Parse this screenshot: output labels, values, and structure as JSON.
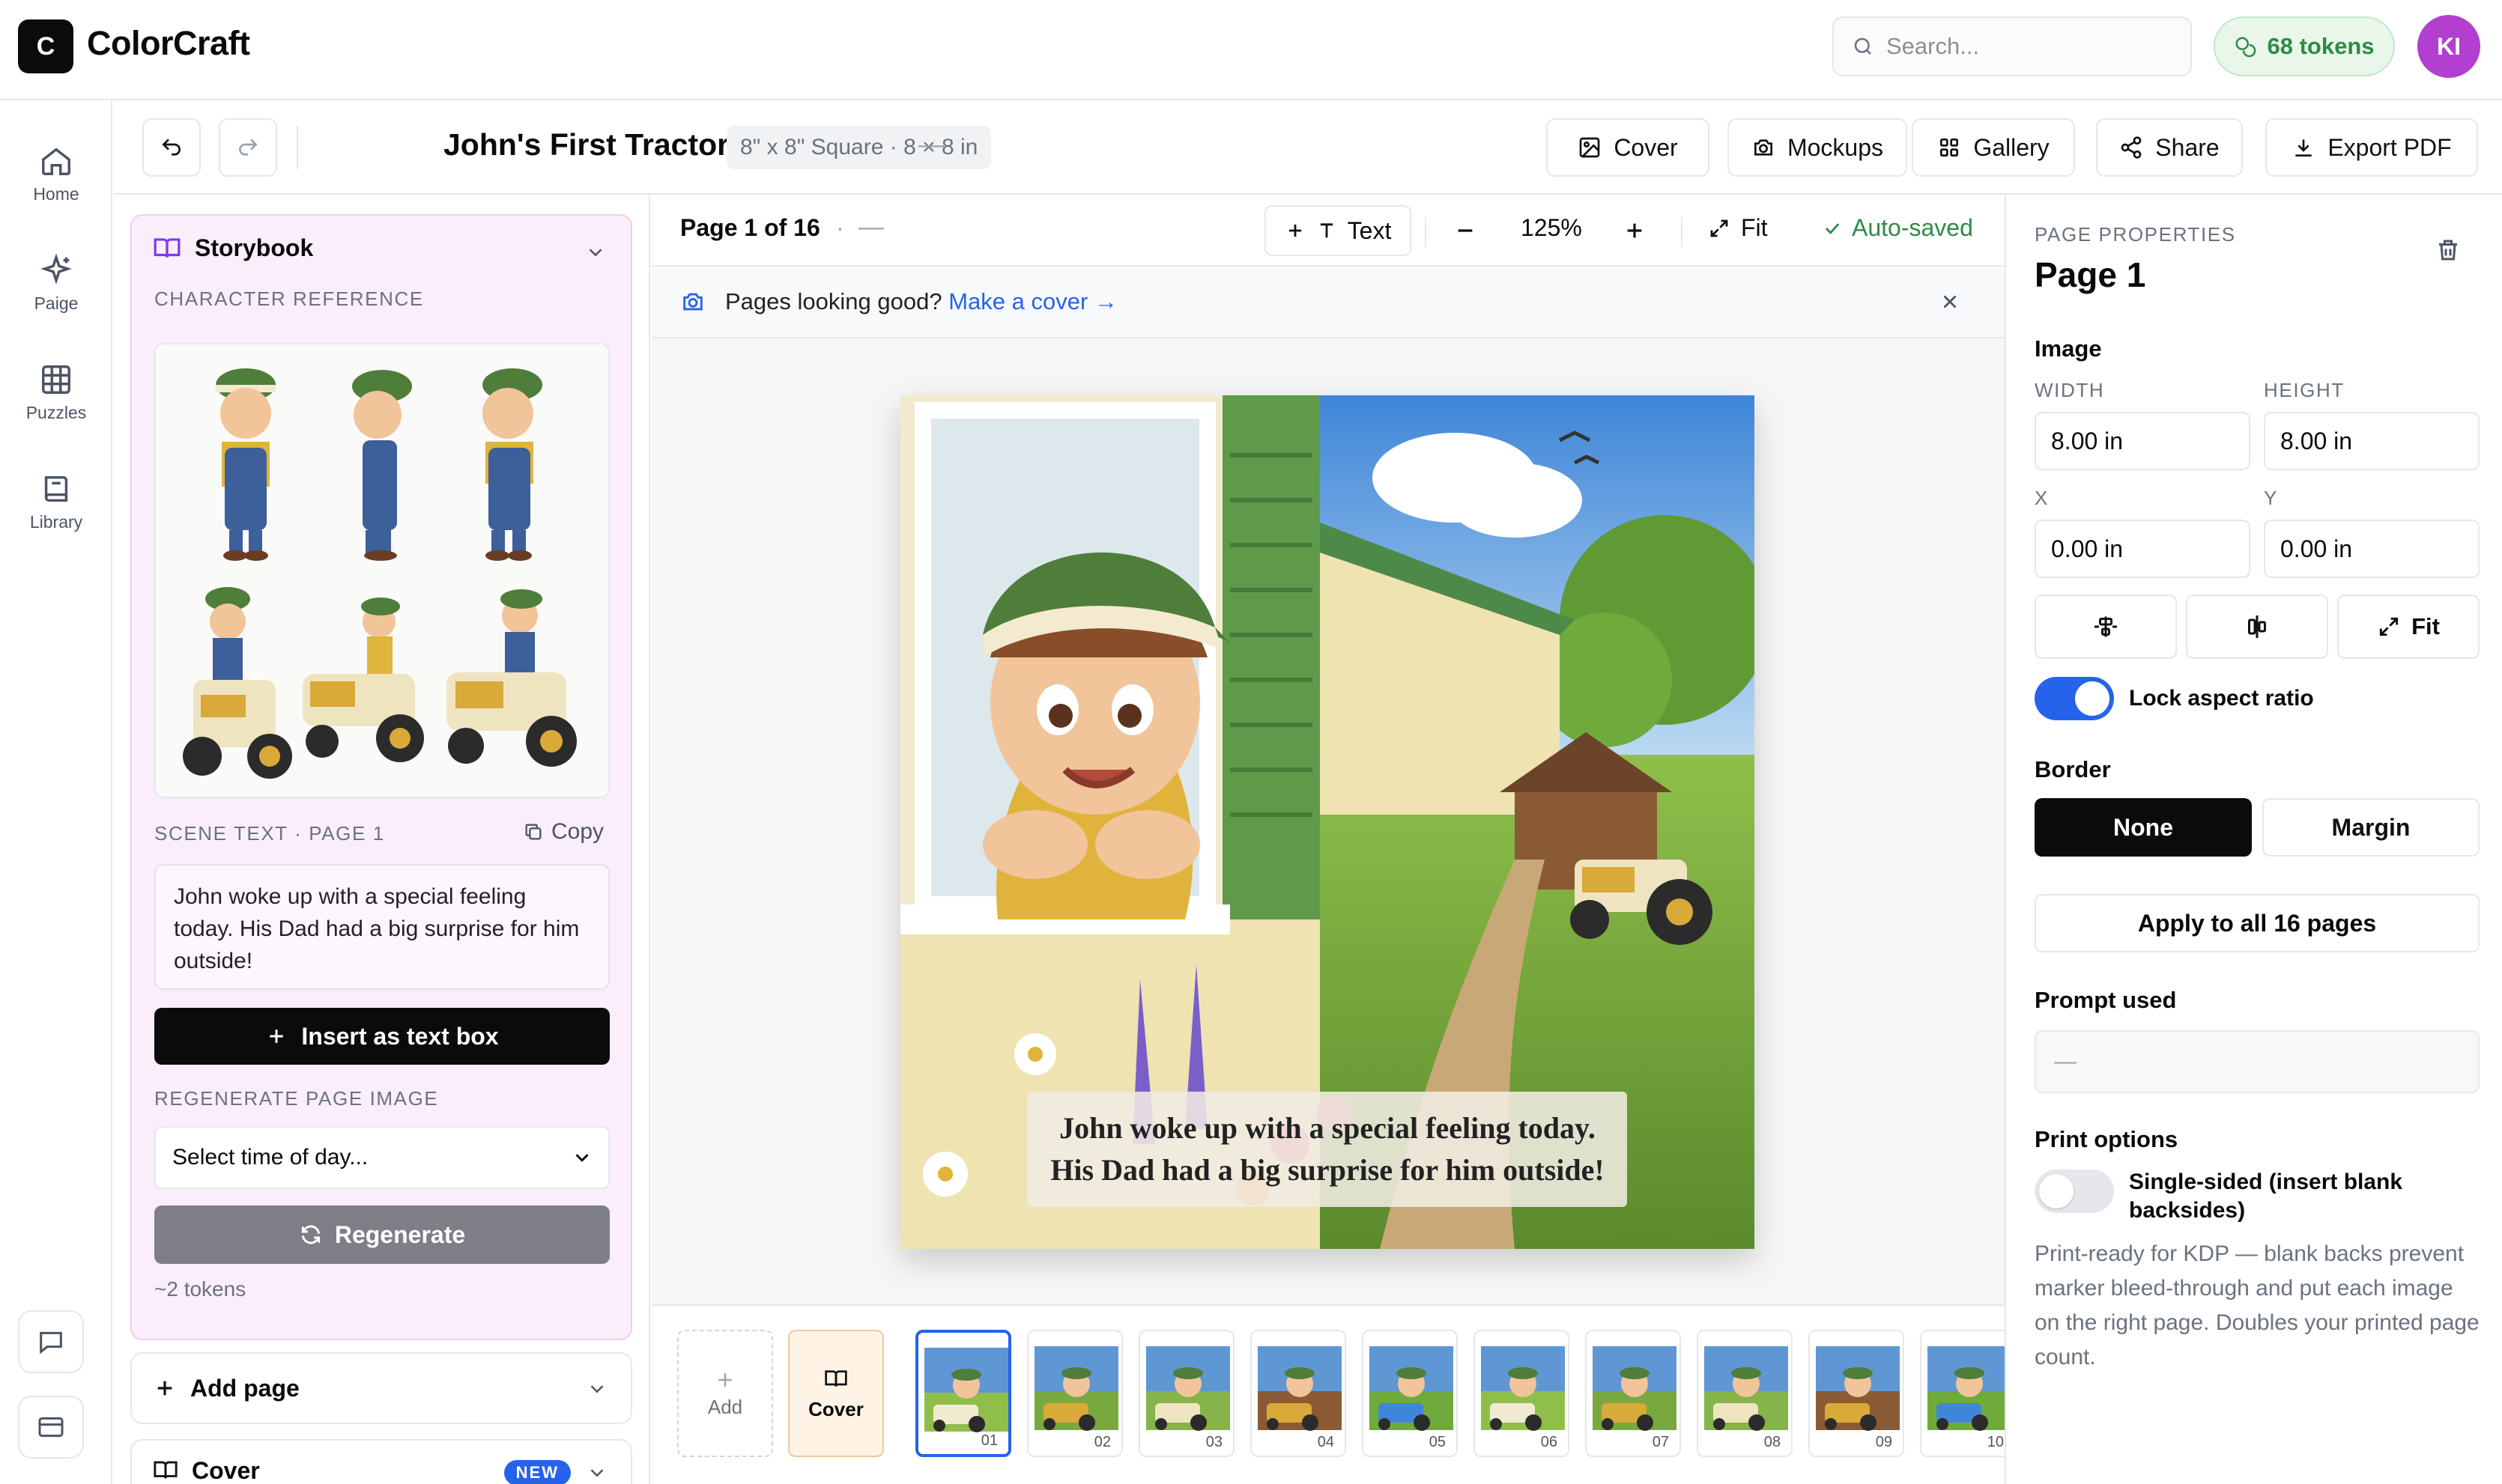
{
  "app": {
    "logo_letter": "C",
    "name": "ColorCraft"
  },
  "header": {
    "search_placeholder": "Search...",
    "tokens": "68 tokens",
    "avatar_initials": "KI"
  },
  "nav": [
    {
      "label": "Home",
      "icon": "home-icon"
    },
    {
      "label": "Paige",
      "icon": "sparkles-icon"
    },
    {
      "label": "Puzzles",
      "icon": "grid-icon"
    },
    {
      "label": "Library",
      "icon": "book-icon"
    }
  ],
  "toolbar": {
    "title": "John's First Tractor",
    "size": "8\" x 8\" Square · 8 × 8 in",
    "dash": "—",
    "cover": "Cover",
    "mockups": "Mockups",
    "gallery": "Gallery",
    "share": "Share",
    "export": "Export PDF"
  },
  "storybook": {
    "title": "Storybook",
    "character_reference_label": "CHARACTER REFERENCE",
    "scene_text_label": "SCENE TEXT · PAGE 1",
    "copy_label": "Copy",
    "scene_text": "John woke up with a special feeling today. His Dad had a big surprise for him outside!",
    "insert_button": "Insert as text box",
    "regenerate_label": "REGENERATE PAGE IMAGE",
    "time_of_day_selected": "Select time of day...",
    "regenerate_button": "Regenerate",
    "token_cost": "~2 tokens"
  },
  "add_page": {
    "label": "Add page"
  },
  "cover_section": {
    "label": "Cover",
    "badge": "NEW"
  },
  "pagebar": {
    "page_indicator": "Page 1 of 16",
    "sep": "·",
    "dash": "—",
    "text_button": "Text",
    "zoom": "125%",
    "fit": "Fit",
    "saved": "Auto-saved"
  },
  "banner": {
    "text": "Pages looking good?",
    "link": "Make a cover →"
  },
  "page": {
    "caption": "John woke up with a special feeling today. His Dad had a big surprise for him outside!"
  },
  "thumbstrip": {
    "add": "Add",
    "cover": "Cover",
    "pages": [
      "01",
      "02",
      "03",
      "04",
      "05",
      "06",
      "07",
      "08",
      "09",
      "10"
    ]
  },
  "properties": {
    "section_label": "PAGE PROPERTIES",
    "page_title": "Page 1",
    "image_heading": "Image",
    "width_label": "WIDTH",
    "height_label": "HEIGHT",
    "width": "8.00 in",
    "height": "8.00 in",
    "x_label": "X",
    "y_label": "Y",
    "x": "0.00 in",
    "y": "0.00 in",
    "fit": "Fit",
    "lock_aspect": "Lock aspect ratio",
    "lock_aspect_on": true,
    "border_heading": "Border",
    "border_none": "None",
    "border_margin": "Margin",
    "border_selected": "None",
    "apply_all": "Apply to all 16 pages",
    "prompt_heading": "Prompt used",
    "prompt_value": "—",
    "print_heading": "Print options",
    "single_sided": "Single-sided (insert blank backsides)",
    "single_sided_on": false,
    "print_help": "Print-ready for KDP — blank backs prevent marker bleed-through and put each image on the right page. Doubles your printed page count."
  },
  "colors": {
    "accent": "#2563eb",
    "success": "#2f8a45",
    "avatar": "#b23fd0",
    "storybook_bg": "#fbeefb"
  }
}
